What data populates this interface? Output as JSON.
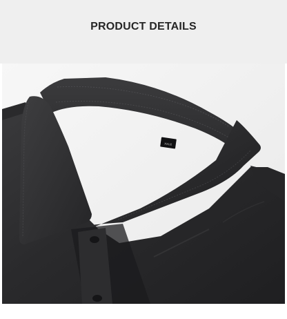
{
  "header": {
    "title": "PRODUCT DETAILS",
    "background": "#efefef",
    "text_color": "#262626"
  },
  "photo": {
    "subject": "shirt-collar-closeup",
    "garment_color": "#2b2b2d",
    "tag_text": "XXL/2"
  }
}
